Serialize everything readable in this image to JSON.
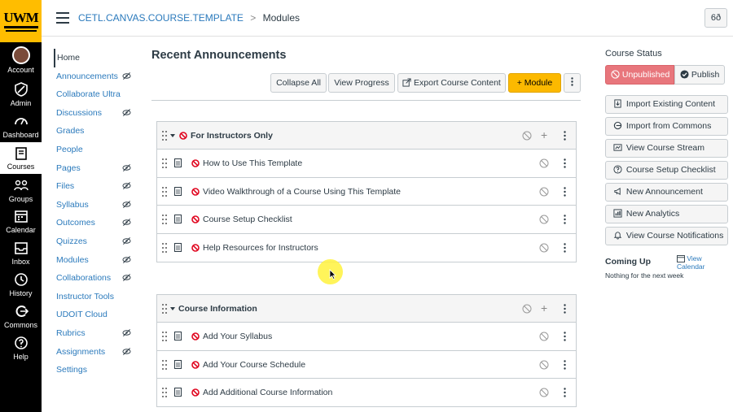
{
  "global_nav": {
    "logo_text": "UWM",
    "items": [
      {
        "label": "Account",
        "icon": "avatar"
      },
      {
        "label": "Admin",
        "icon": "shield-icon"
      },
      {
        "label": "Dashboard",
        "icon": "dashboard-icon"
      },
      {
        "label": "Courses",
        "icon": "book-icon"
      },
      {
        "label": "Groups",
        "icon": "groups-icon"
      },
      {
        "label": "Calendar",
        "icon": "calendar-icon"
      },
      {
        "label": "Inbox",
        "icon": "inbox-icon"
      },
      {
        "label": "History",
        "icon": "clock-icon"
      },
      {
        "label": "Commons",
        "icon": "commons-icon"
      },
      {
        "label": "Help",
        "icon": "help-icon"
      }
    ]
  },
  "header": {
    "breadcrumb_course": "CETL.CANVAS.COURSE.TEMPLATE",
    "breadcrumb_sep": ">",
    "breadcrumb_page": "Modules",
    "glasses_icon": "glasses-icon"
  },
  "course_nav": [
    {
      "label": "Home",
      "hidden": false
    },
    {
      "label": "Announcements",
      "hidden": true
    },
    {
      "label": "Collaborate Ultra",
      "hidden": false
    },
    {
      "label": "Discussions",
      "hidden": true
    },
    {
      "label": "Grades",
      "hidden": false
    },
    {
      "label": "People",
      "hidden": false
    },
    {
      "label": "Pages",
      "hidden": true
    },
    {
      "label": "Files",
      "hidden": true
    },
    {
      "label": "Syllabus",
      "hidden": true
    },
    {
      "label": "Outcomes",
      "hidden": true
    },
    {
      "label": "Quizzes",
      "hidden": true
    },
    {
      "label": "Modules",
      "hidden": true
    },
    {
      "label": "Collaborations",
      "hidden": true
    },
    {
      "label": "Instructor Tools",
      "hidden": false
    },
    {
      "label": "UDOIT Cloud",
      "hidden": false
    },
    {
      "label": "Rubrics",
      "hidden": true
    },
    {
      "label": "Assignments",
      "hidden": true
    },
    {
      "label": "Settings",
      "hidden": false
    }
  ],
  "main": {
    "title": "Recent Announcements",
    "toolbar": {
      "collapse_all": "Collapse All",
      "view_progress": "View Progress",
      "export": "Export Course Content",
      "add_module": "Module",
      "add_module_plus": "+"
    },
    "modules": [
      {
        "title": "For Instructors Only",
        "items": [
          "How to Use This Template",
          "Video Walkthrough of a Course Using This Template",
          "Course Setup Checklist",
          "Help Resources for Instructors"
        ]
      },
      {
        "title": "Course Information",
        "items": [
          "Add Your Syllabus",
          "Add Your Course Schedule",
          "Add Additional Course Information"
        ]
      }
    ]
  },
  "sidebar": {
    "course_status": "Course Status",
    "unpublished": "Unpublished",
    "publish": "Publish",
    "buttons": [
      "Import Existing Content",
      "Import from Commons",
      "View Course Stream",
      "Course Setup Checklist",
      "New Announcement",
      "New Analytics",
      "View Course Notifications"
    ],
    "coming_up": "Coming Up",
    "view_calendar": "View Calendar",
    "nothing": "Nothing for the next week"
  },
  "colors": {
    "brand_gold": "#ffbd00",
    "unpublished_red": "#e8767c",
    "link_blue": "#2b7abc",
    "primary_button": "#fcb900"
  }
}
